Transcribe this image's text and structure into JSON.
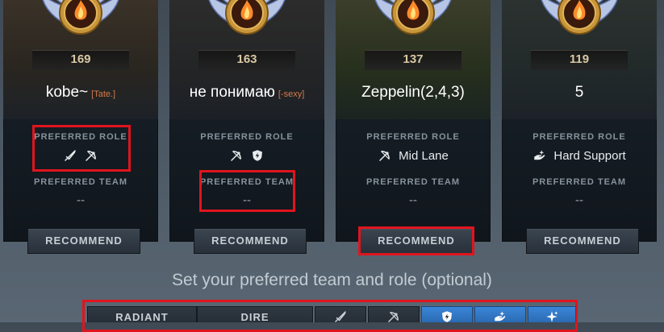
{
  "cards": [
    {
      "level": "169",
      "name": "kobe~",
      "tag": "[Tate.]",
      "preferred_role_label": "PREFERRED ROLE",
      "roles_text": "",
      "role_icons": [
        "sword-icon",
        "bow-icon"
      ],
      "preferred_team_label": "PREFERRED TEAM",
      "team_value": "--",
      "recommend_label": "RECOMMEND"
    },
    {
      "level": "163",
      "name": "не понимаю",
      "tag": "[-sexy]",
      "preferred_role_label": "PREFERRED ROLE",
      "roles_text": "",
      "role_icons": [
        "bow-icon",
        "lightning-shield-icon"
      ],
      "preferred_team_label": "PREFERRED TEAM",
      "team_value": "--",
      "recommend_label": "RECOMMEND"
    },
    {
      "level": "137",
      "name": "Zeppelin(2,4,3)",
      "tag": "",
      "preferred_role_label": "PREFERRED ROLE",
      "roles_text": "Mid Lane",
      "role_icons": [
        "bow-icon"
      ],
      "preferred_team_label": "PREFERRED TEAM",
      "team_value": "--",
      "recommend_label": "RECOMMEND"
    },
    {
      "level": "119",
      "name": "5",
      "tag": "",
      "preferred_role_label": "PREFERRED ROLE",
      "roles_text": "Hard Support",
      "role_icons": [
        "hand-sparkle-icon"
      ],
      "preferred_team_label": "PREFERRED TEAM",
      "team_value": "--",
      "recommend_label": "RECOMMEND"
    }
  ],
  "prompt": "Set your preferred team and role (optional)",
  "options": {
    "teams": [
      "RADIANT",
      "DIRE"
    ],
    "roles": [
      {
        "icon": "sword-icon",
        "selected": false
      },
      {
        "icon": "bow-icon",
        "selected": false
      },
      {
        "icon": "lightning-shield-icon",
        "selected": true
      },
      {
        "icon": "hand-sparkle-icon",
        "selected": true
      },
      {
        "icon": "sparkle-icon",
        "selected": true
      }
    ]
  },
  "colors": {
    "highlight": "#e0141e",
    "selected_role": "#3b86d8",
    "clan_tag": "#d47a4b"
  }
}
